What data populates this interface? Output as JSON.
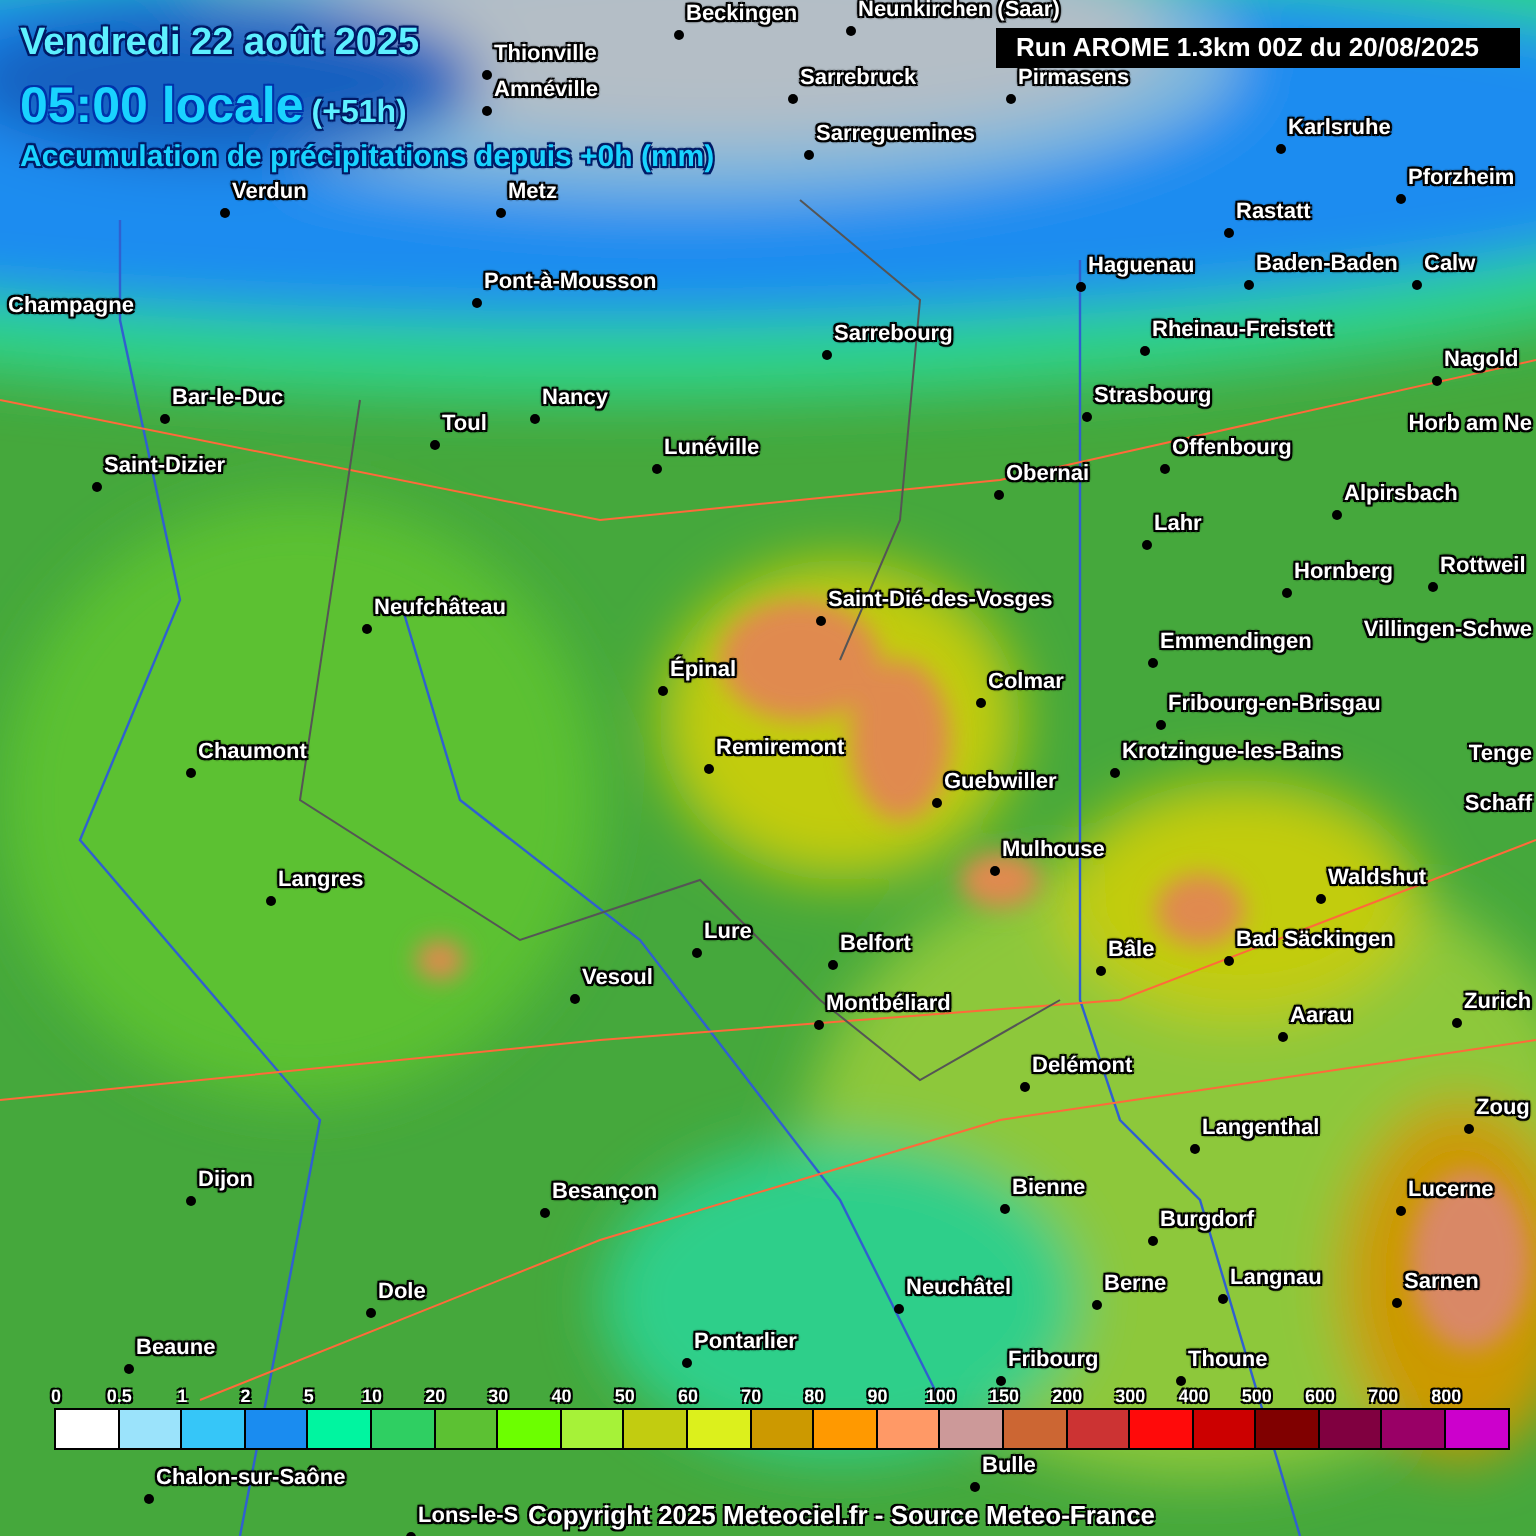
{
  "header": {
    "date": "Vendredi 22 août 2025",
    "time": "05:00 locale",
    "offset": "(+51h)",
    "subtitle": "Accumulation de précipitations depuis +0h (mm)"
  },
  "run_label": "Run AROME 1.3km 00Z du 20/08/2025",
  "cities": [
    {
      "name": "Beckingen"
    },
    {
      "name": "Neunkirchen (Saar)"
    },
    {
      "name": "Thionville"
    },
    {
      "name": "Amnéville"
    },
    {
      "name": "Sarrebruck"
    },
    {
      "name": "Pirmasens"
    },
    {
      "name": "Sarreguemines"
    },
    {
      "name": "Karlsruhe"
    },
    {
      "name": "Verdun"
    },
    {
      "name": "Metz"
    },
    {
      "name": "Pforzheim"
    },
    {
      "name": "Rastatt"
    },
    {
      "name": "Champagne"
    },
    {
      "name": "Pont-à-Mousson"
    },
    {
      "name": "Haguenau"
    },
    {
      "name": "Baden-Baden"
    },
    {
      "name": "Calw"
    },
    {
      "name": "Sarrebourg"
    },
    {
      "name": "Rheinau-Freistett"
    },
    {
      "name": "Nagold"
    },
    {
      "name": "Bar-le-Duc"
    },
    {
      "name": "Nancy"
    },
    {
      "name": "Strasbourg"
    },
    {
      "name": "Toul"
    },
    {
      "name": "Horb am Ne"
    },
    {
      "name": "Saint-Dizier"
    },
    {
      "name": "Lunéville"
    },
    {
      "name": "Obernai"
    },
    {
      "name": "Offenbourg"
    },
    {
      "name": "Alpirsbach"
    },
    {
      "name": "Lahr"
    },
    {
      "name": "Hornberg"
    },
    {
      "name": "Rottweil"
    },
    {
      "name": "Neufchâteau"
    },
    {
      "name": "Saint-Dié-des-Vosges"
    },
    {
      "name": "Emmendingen"
    },
    {
      "name": "Villingen-Schwe"
    },
    {
      "name": "Épinal"
    },
    {
      "name": "Colmar"
    },
    {
      "name": "Fribourg-en-Brisgau"
    },
    {
      "name": "Chaumont"
    },
    {
      "name": "Remiremont"
    },
    {
      "name": "Krotzingue-les-Bains"
    },
    {
      "name": "Tenge"
    },
    {
      "name": "Guebwiller"
    },
    {
      "name": "Schaff"
    },
    {
      "name": "Mulhouse"
    },
    {
      "name": "Langres"
    },
    {
      "name": "Waldshut"
    },
    {
      "name": "Lure"
    },
    {
      "name": "Belfort"
    },
    {
      "name": "Bâle"
    },
    {
      "name": "Bad Säckingen"
    },
    {
      "name": "Vesoul"
    },
    {
      "name": "Montbéliard"
    },
    {
      "name": "Aarau"
    },
    {
      "name": "Zurich"
    },
    {
      "name": "Delémont"
    },
    {
      "name": "Zoug"
    },
    {
      "name": "Langenthal"
    },
    {
      "name": "Dijon"
    },
    {
      "name": "Besançon"
    },
    {
      "name": "Bienne"
    },
    {
      "name": "Lucerne"
    },
    {
      "name": "Burgdorf"
    },
    {
      "name": "Dole"
    },
    {
      "name": "Neuchâtel"
    },
    {
      "name": "Berne"
    },
    {
      "name": "Langnau"
    },
    {
      "name": "Sarnen"
    },
    {
      "name": "Beaune"
    },
    {
      "name": "Pontarlier"
    },
    {
      "name": "Fribourg"
    },
    {
      "name": "Thoune"
    },
    {
      "name": "Chalon-sur-Saône"
    },
    {
      "name": "Bulle"
    },
    {
      "name": "Lons-le-S"
    }
  ],
  "legend": [
    {
      "label": "0",
      "color": "#ffffff"
    },
    {
      "label": "0.5",
      "color": "#9be3fb"
    },
    {
      "label": "1",
      "color": "#36c6f8"
    },
    {
      "label": "2",
      "color": "#1a8cf0"
    },
    {
      "label": "5",
      "color": "#00f5a0"
    },
    {
      "label": "10",
      "color": "#2fcf62"
    },
    {
      "label": "20",
      "color": "#5cc133"
    },
    {
      "label": "30",
      "color": "#6cff00"
    },
    {
      "label": "40",
      "color": "#a6f238"
    },
    {
      "label": "50",
      "color": "#c2cc10"
    },
    {
      "label": "60",
      "color": "#dcf01c"
    },
    {
      "label": "70",
      "color": "#cc9900"
    },
    {
      "label": "80",
      "color": "#ff9900"
    },
    {
      "label": "90",
      "color": "#ff9966"
    },
    {
      "label": "100",
      "color": "#cc9999"
    },
    {
      "label": "150",
      "color": "#cc6633"
    },
    {
      "label": "200",
      "color": "#cc3333"
    },
    {
      "label": "300",
      "color": "#ff0a0a"
    },
    {
      "label": "400",
      "color": "#cc0000"
    },
    {
      "label": "500",
      "color": "#800000"
    },
    {
      "label": "600",
      "color": "#800040"
    },
    {
      "label": "700",
      "color": "#990066"
    },
    {
      "label": "800",
      "color": "#cc00cc"
    }
  ],
  "copyright": "Copyright 2025 Meteociel.fr - Source Meteo-France"
}
